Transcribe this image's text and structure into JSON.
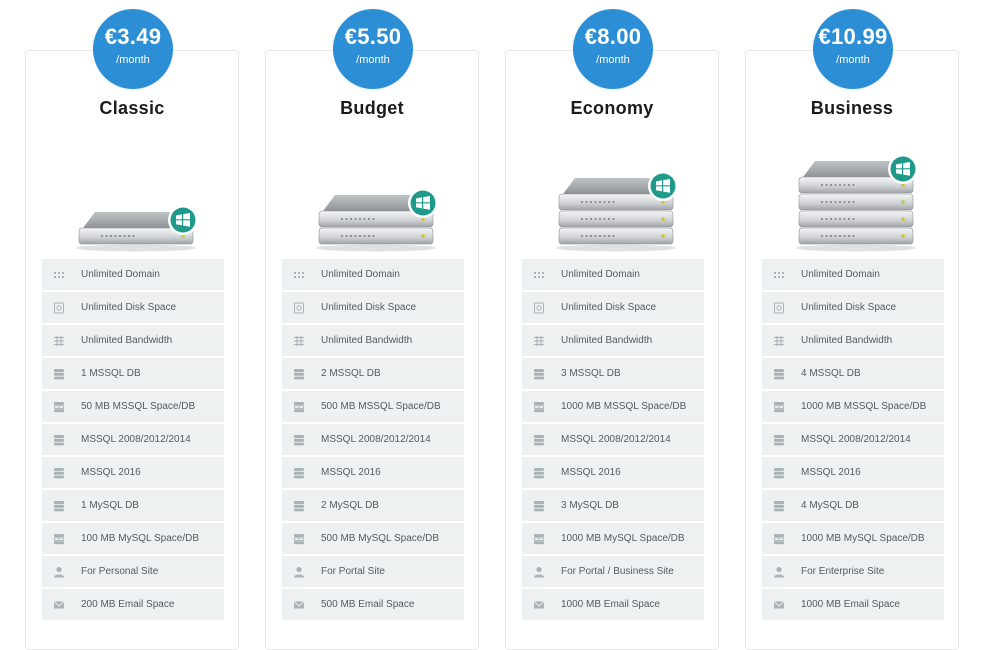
{
  "colors": {
    "accent": "#2c8fd6",
    "feature_bg": "#edf1f2",
    "windows_badge": "#1f9a8a"
  },
  "plans": [
    {
      "price": "€3.49",
      "period": "/month",
      "name": "Classic",
      "server_units": 1,
      "features": [
        {
          "icon": "domain-icon",
          "text": "Unlimited Domain"
        },
        {
          "icon": "disk-icon",
          "text": "Unlimited Disk Space"
        },
        {
          "icon": "bandwidth-icon",
          "text": "Unlimited Bandwidth"
        },
        {
          "icon": "database-icon",
          "text": "1 MSSQL DB"
        },
        {
          "icon": "db-space-icon",
          "text": "50 MB MSSQL Space/DB"
        },
        {
          "icon": "database-icon",
          "text": "MSSQL 2008/2012/2014"
        },
        {
          "icon": "database-icon",
          "text": "MSSQL 2016"
        },
        {
          "icon": "database-icon",
          "text": "1 MySQL DB"
        },
        {
          "icon": "db-space-icon",
          "text": "100 MB MySQL Space/DB"
        },
        {
          "icon": "user-icon",
          "text": "For Personal Site"
        },
        {
          "icon": "email-icon",
          "text": "200 MB Email Space"
        }
      ]
    },
    {
      "price": "€5.50",
      "period": "/month",
      "name": "Budget",
      "server_units": 2,
      "features": [
        {
          "icon": "domain-icon",
          "text": "Unlimited Domain"
        },
        {
          "icon": "disk-icon",
          "text": "Unlimited Disk Space"
        },
        {
          "icon": "bandwidth-icon",
          "text": "Unlimited Bandwidth"
        },
        {
          "icon": "database-icon",
          "text": "2 MSSQL DB"
        },
        {
          "icon": "db-space-icon",
          "text": "500 MB MSSQL Space/DB"
        },
        {
          "icon": "database-icon",
          "text": "MSSQL 2008/2012/2014"
        },
        {
          "icon": "database-icon",
          "text": "MSSQL 2016"
        },
        {
          "icon": "database-icon",
          "text": "2 MySQL DB"
        },
        {
          "icon": "db-space-icon",
          "text": "500 MB MySQL Space/DB"
        },
        {
          "icon": "user-icon",
          "text": "For Portal Site"
        },
        {
          "icon": "email-icon",
          "text": "500 MB Email Space"
        }
      ]
    },
    {
      "price": "€8.00",
      "period": "/month",
      "name": "Economy",
      "server_units": 3,
      "features": [
        {
          "icon": "domain-icon",
          "text": "Unlimited Domain"
        },
        {
          "icon": "disk-icon",
          "text": "Unlimited Disk Space"
        },
        {
          "icon": "bandwidth-icon",
          "text": "Unlimited Bandwidth"
        },
        {
          "icon": "database-icon",
          "text": "3 MSSQL DB"
        },
        {
          "icon": "db-space-icon",
          "text": "1000 MB MSSQL Space/DB"
        },
        {
          "icon": "database-icon",
          "text": "MSSQL 2008/2012/2014"
        },
        {
          "icon": "database-icon",
          "text": "MSSQL 2016"
        },
        {
          "icon": "database-icon",
          "text": "3 MySQL DB"
        },
        {
          "icon": "db-space-icon",
          "text": "1000 MB MySQL Space/DB"
        },
        {
          "icon": "user-icon",
          "text": "For Portal / Business Site"
        },
        {
          "icon": "email-icon",
          "text": "1000 MB Email Space"
        }
      ]
    },
    {
      "price": "€10.99",
      "period": "/month",
      "name": "Business",
      "server_units": 4,
      "features": [
        {
          "icon": "domain-icon",
          "text": "Unlimited Domain"
        },
        {
          "icon": "disk-icon",
          "text": "Unlimited Disk Space"
        },
        {
          "icon": "bandwidth-icon",
          "text": "Unlimited Bandwidth"
        },
        {
          "icon": "database-icon",
          "text": "4 MSSQL DB"
        },
        {
          "icon": "db-space-icon",
          "text": "1000 MB MSSQL Space/DB"
        },
        {
          "icon": "database-icon",
          "text": "MSSQL 2008/2012/2014"
        },
        {
          "icon": "database-icon",
          "text": "MSSQL 2016"
        },
        {
          "icon": "database-icon",
          "text": "4 MySQL DB"
        },
        {
          "icon": "db-space-icon",
          "text": "1000 MB MySQL Space/DB"
        },
        {
          "icon": "user-icon",
          "text": "For Enterprise Site"
        },
        {
          "icon": "email-icon",
          "text": "1000 MB Email Space"
        }
      ]
    }
  ]
}
